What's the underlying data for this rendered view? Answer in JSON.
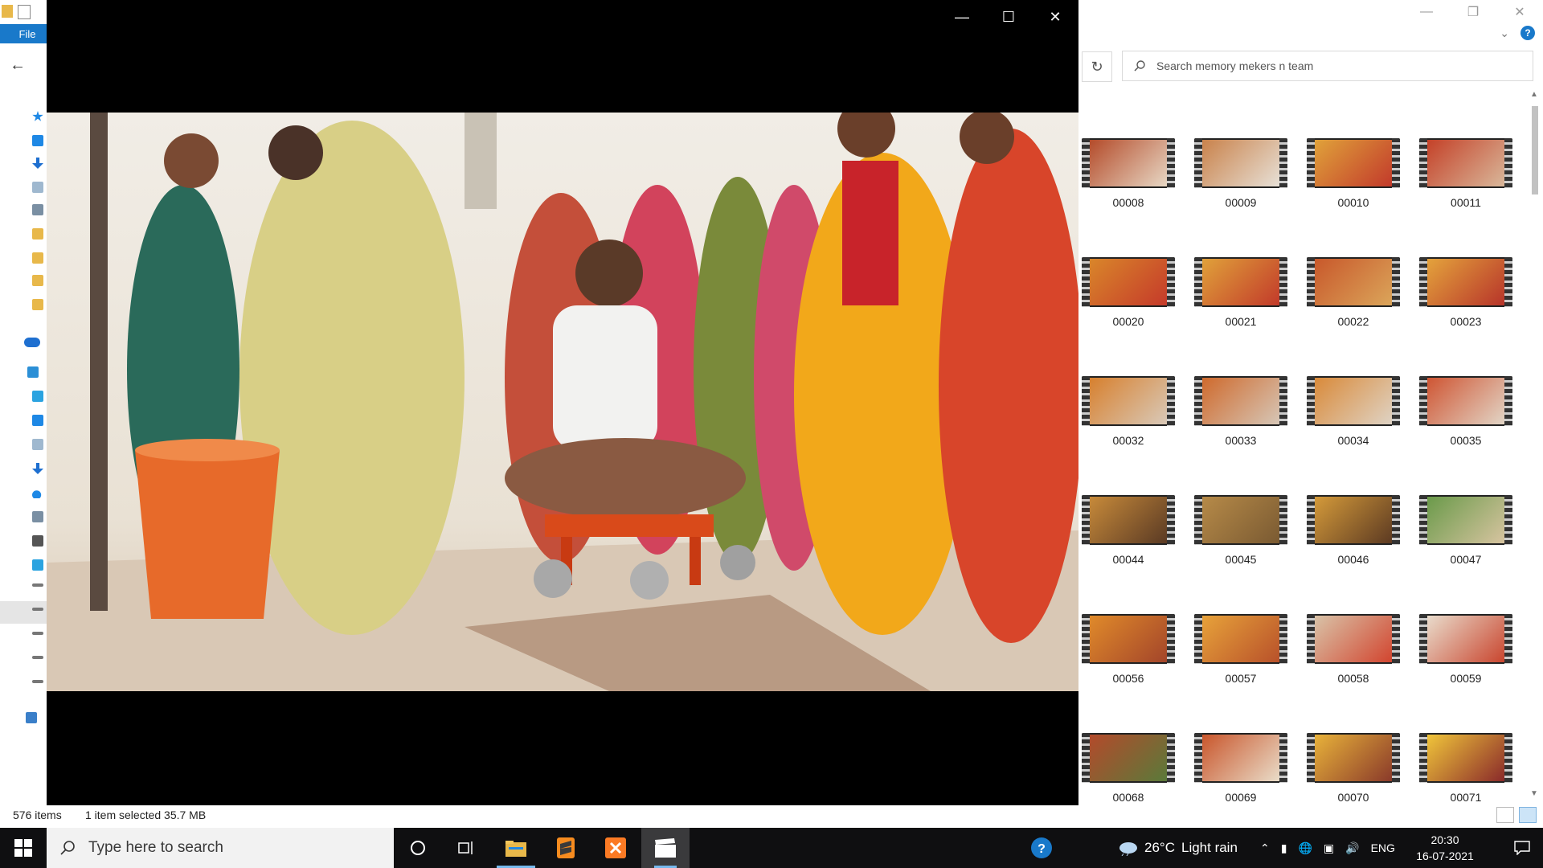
{
  "explorer": {
    "ribbon": {
      "file_tab": "File"
    },
    "search": {
      "placeholder": "Search memory mekers n team"
    },
    "items": [
      {
        "name": "00008",
        "c1": "#b44b2a",
        "c2": "#e7d7c4"
      },
      {
        "name": "00009",
        "c1": "#c9824b",
        "c2": "#e7e0d6"
      },
      {
        "name": "00010",
        "c1": "#e0a23a",
        "c2": "#c23a2b"
      },
      {
        "name": "00011",
        "c1": "#c44128",
        "c2": "#d9b79a"
      },
      {
        "name": "00020",
        "c1": "#d9862a",
        "c2": "#c53a2a"
      },
      {
        "name": "00021",
        "c1": "#e0a13a",
        "c2": "#c23a2a"
      },
      {
        "name": "00022",
        "c1": "#c8582b",
        "c2": "#dba55a"
      },
      {
        "name": "00023",
        "c1": "#e4a33c",
        "c2": "#b7342a"
      },
      {
        "name": "00032",
        "c1": "#d7802e",
        "c2": "#d9c9b8"
      },
      {
        "name": "00033",
        "c1": "#cf6a2d",
        "c2": "#d6c6b6"
      },
      {
        "name": "00034",
        "c1": "#d98a3a",
        "c2": "#dfd3c4"
      },
      {
        "name": "00035",
        "c1": "#cf5533",
        "c2": "#e2d5c6"
      },
      {
        "name": "00044",
        "c1": "#c78a3a",
        "c2": "#5a3a24"
      },
      {
        "name": "00045",
        "c1": "#b68a48",
        "c2": "#7a5a32"
      },
      {
        "name": "00046",
        "c1": "#d49a3a",
        "c2": "#5c3a22"
      },
      {
        "name": "00047",
        "c1": "#6a9a4a",
        "c2": "#d7c4a0"
      },
      {
        "name": "00056",
        "c1": "#e08a2a",
        "c2": "#a3452a"
      },
      {
        "name": "00057",
        "c1": "#e7a23a",
        "c2": "#b8512a"
      },
      {
        "name": "00058",
        "c1": "#d9c3a8",
        "c2": "#d2452f"
      },
      {
        "name": "00059",
        "c1": "#e9dccc",
        "c2": "#c9452e"
      },
      {
        "name": "00068",
        "c1": "#b34a2b",
        "c2": "#5a7a3a"
      },
      {
        "name": "00069",
        "c1": "#c9562c",
        "c2": "#e9dcc8"
      },
      {
        "name": "00070",
        "c1": "#e8b23a",
        "c2": "#8a3a2a"
      },
      {
        "name": "00071",
        "c1": "#f0c53a",
        "c2": "#8a2a2a"
      }
    ],
    "status": {
      "item_count": "576 items",
      "selection": "1 item selected  35.7 MB"
    }
  },
  "player": {
    "controls": {
      "minimize": "—",
      "maximize": "☐",
      "close": "✕"
    }
  },
  "taskbar": {
    "search_placeholder": "Type here to search",
    "weather": {
      "temp": "26°C",
      "condition": "Light rain"
    },
    "language": "ENG",
    "time": "20:30",
    "date": "16-07-2021"
  },
  "colors": {
    "accent": "#1979ca",
    "taskbar": "#0f0f11",
    "active_indicator": "#76b9ed"
  }
}
